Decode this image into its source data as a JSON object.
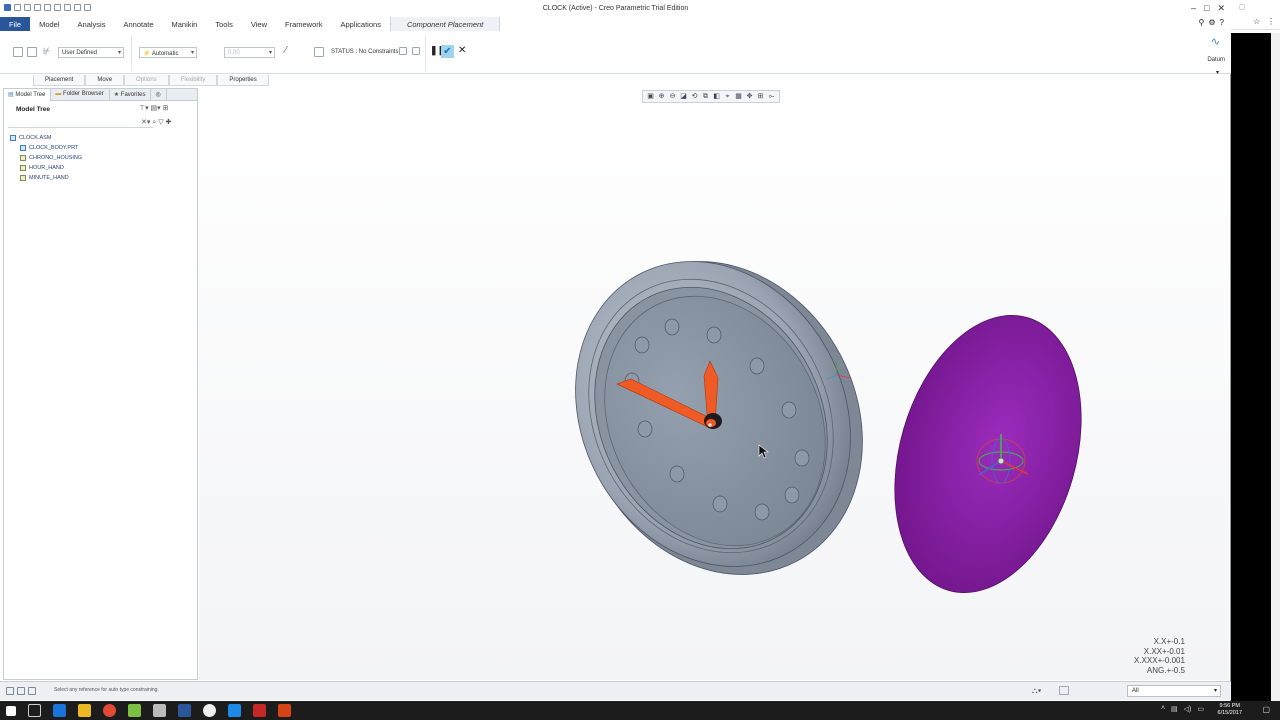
{
  "window": {
    "title": "CLOCK (Active) - Creo Parametric Trial Edition",
    "controls": [
      "–",
      "□",
      "✕"
    ]
  },
  "ribbon_tabs": [
    "File",
    "Model",
    "Analysis",
    "Annotate",
    "Manikin",
    "Tools",
    "View",
    "Framework",
    "Applications",
    "Component Placement"
  ],
  "ribbon": {
    "constraint_type": "User Defined",
    "constraint": "Automatic",
    "offset_value": "0.00",
    "status": "STATUS : No Constraints",
    "datum_label": "Datum"
  },
  "sub_tabs": [
    "Placement",
    "Move",
    "Options",
    "Flexibility",
    "Properties"
  ],
  "panel_tabs": [
    "Model Tree",
    "Folder Browser",
    "Favorites"
  ],
  "model_tree": {
    "title": "Model Tree",
    "items": [
      "CLOCK.ASM",
      "CLOCK_BODY.PRT",
      "CHRONO_HOUSING",
      "HOUR_HAND",
      "MINUTE_HAND"
    ]
  },
  "tolerances": [
    "X.X+-0.1",
    "X.XX+-0.01",
    "X.XXX+-0.001",
    "ANG.+-0.5"
  ],
  "statusbar": {
    "message": "Select any reference for auto type constraining.",
    "filter": "All"
  },
  "taskbar": {
    "time": "9:56 PM",
    "date": "6/15/2017"
  },
  "colors": {
    "file_tab": "#2a5699",
    "clock_face": "#8a96a6",
    "hands": "#f05a24",
    "cover": "#8a1fa6"
  }
}
